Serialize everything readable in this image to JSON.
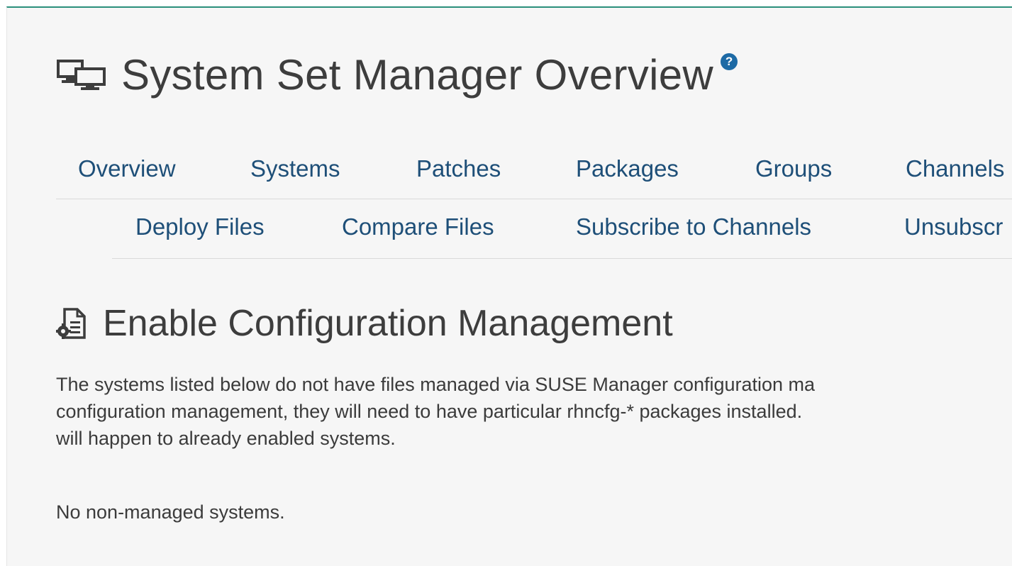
{
  "header": {
    "title": "System Set Manager Overview",
    "help_glyph": "?",
    "title_icon": "desktop-systems-icon",
    "help_icon": "question-circle-icon"
  },
  "tabs_primary": [
    {
      "label": "Overview"
    },
    {
      "label": "Systems"
    },
    {
      "label": "Patches"
    },
    {
      "label": "Packages"
    },
    {
      "label": "Groups"
    },
    {
      "label": "Channels"
    }
  ],
  "tabs_secondary": [
    {
      "label": "Deploy Files"
    },
    {
      "label": "Compare Files"
    },
    {
      "label": "Subscribe to Channels"
    },
    {
      "label": "Unsubscr"
    }
  ],
  "section": {
    "title": "Enable Configuration Management",
    "icon": "file-config-gear-icon",
    "description_lines": [
      "The systems listed below do not have files managed via SUSE Manager configuration ma",
      "configuration management, they will need to have particular rhncfg-* packages installed.",
      "will happen to already enabled systems."
    ],
    "empty_message": "No non-managed systems."
  },
  "colors": {
    "accent_border": "#2b8f7b",
    "link": "#1e4f78",
    "help_badge": "#1d6aa5",
    "text": "#3b3b3b",
    "background": "#f6f6f6"
  }
}
